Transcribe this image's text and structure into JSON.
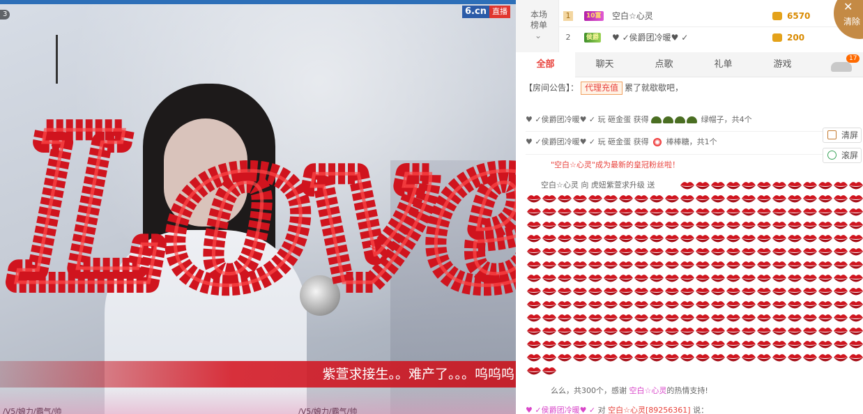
{
  "video": {
    "logo_text": "6.cn",
    "live_text": "直播",
    "corner_number": "3",
    "caption": "紫萱求接生。。难产了。。。呜呜呜",
    "bottom_left_text": "/V5/娘力/霸气/帅",
    "bottom_right_text": "/V5/娘力/霸气/帅",
    "overlay_word": "Love",
    "overlay_color": "#d0141e"
  },
  "ranking": {
    "title": "本场榜单",
    "rows": [
      {
        "rank": "1",
        "badge": "10富",
        "name": "空白☆心灵",
        "score": "6570"
      },
      {
        "rank": "2",
        "badge": "侯爵",
        "name": "♥ ✓侯爵团冷暖♥ ✓",
        "score": "200"
      }
    ]
  },
  "clear_button": {
    "label": "清除"
  },
  "tabs": [
    {
      "label": "全部",
      "active": true
    },
    {
      "label": "聊天",
      "active": false
    },
    {
      "label": "点歌",
      "active": false
    },
    {
      "label": "礼单",
      "active": false
    },
    {
      "label": "游戏",
      "active": false
    }
  ],
  "car_badge_count": "17",
  "notice": {
    "label": "【房间公告】：",
    "link": "代理充值",
    "text": "累了就歇歇吧，"
  },
  "messages": [
    {
      "user": "♥ ✓侯爵团冷暖♥ ✓",
      "action": "玩 砸金蛋 获得",
      "gift": "绿帽子，共4个"
    },
    {
      "user": "♥ ✓侯爵团冷暖♥ ✓",
      "action": "玩 砸金蛋 获得",
      "gift": "棒棒糖，共1个"
    }
  ],
  "crown_message": "\"空白☆心灵\"成为最新的皇冠粉丝啦！",
  "gift_message": {
    "user": "空白☆心灵",
    "to_word": "向",
    "target": "虎妞紫萱求升级",
    "send_word": "送",
    "end_text": "么么，共300个，感谢",
    "end_user": "空白☆心灵",
    "end_suffix": "的热情支持!"
  },
  "side_buttons": {
    "clear": "清屏",
    "scroll": "滚屏"
  },
  "last_message": {
    "user": "♥ ✓侯爵团冷暖♥ ✓",
    "to_word": "对",
    "target": "空白☆心灵[89256361]",
    "say_word": "说："
  }
}
